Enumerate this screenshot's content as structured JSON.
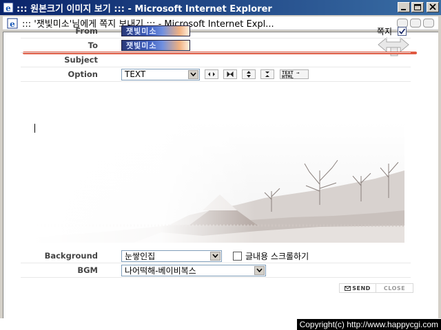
{
  "outer_window": {
    "title": "::: 원본크기 이미지 보기 ::: - Microsoft Internet Explorer"
  },
  "inner_window": {
    "title": "::: '잿빛미소'님에게 쪽지 보내기 ::: - Microsoft Internet Expl..."
  },
  "form": {
    "from_label": "From",
    "from_value": "잿빛미소",
    "to_label": "To",
    "to_value": "잿빛미소",
    "memo_label": "쪽지",
    "memo_checked": true,
    "subject_label": "Subject",
    "option_label": "Option",
    "option_selected": "TEXT",
    "html_button_text": "TEXT → HTML",
    "background_label": "Background",
    "background_selected": "눈쌓인집",
    "scroll_label": "글내용 스크롤하기",
    "scroll_checked": false,
    "bgm_label": "BGM",
    "bgm_selected": "나어떡해-베이비복스"
  },
  "actions": {
    "send": "SEND",
    "close": "CLOSE"
  },
  "footer": {
    "copyright": "Copyright(c) http://www.happycgi.com"
  },
  "colors": {
    "accent_line": "#e05a42",
    "titlebar": "#0a246a",
    "frame": "#d4d0c8"
  }
}
